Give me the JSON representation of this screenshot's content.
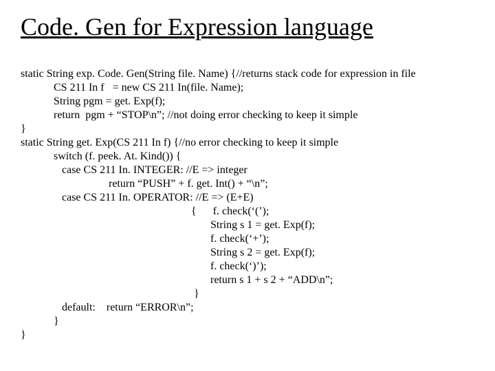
{
  "title": "Code. Gen for Expression language",
  "lines": {
    "l1": "static String exp. Code. Gen(String file. Name) {//returns stack code for expression in file",
    "l2": "            CS 211 In f   = new CS 211 In(file. Name);",
    "l3": "            String pgm = get. Exp(f);",
    "l4": "            return  pgm + “STOP\\n”; //not doing error checking to keep it simple",
    "l5": "}",
    "l6": "static String get. Exp(CS 211 In f) {//no error checking to keep it simple",
    "l7": "            switch (f. peek. At. Kind()) {",
    "l8": "               case CS 211 In. INTEGER: //E => integer",
    "l9": "                                return “PUSH” + f. get. Int() + “\\n”;",
    "l10": "               case CS 211 In. OPERATOR: //E => (E+E)",
    "l11": "                                                              {      f. check(‘(’);",
    "l12": "                                                                     String s 1 = get. Exp(f);",
    "l13": "                                                                     f. check(‘+’);",
    "l14": "                                                                     String s 2 = get. Exp(f);",
    "l15": "                                                                     f. check(‘)’);",
    "l16": "                                                                     return s 1 + s 2 + “ADD\\n”;",
    "l17": "                                                               }",
    "l18": "               default:    return “ERROR\\n”;",
    "l19": "            }",
    "l20": "}"
  }
}
